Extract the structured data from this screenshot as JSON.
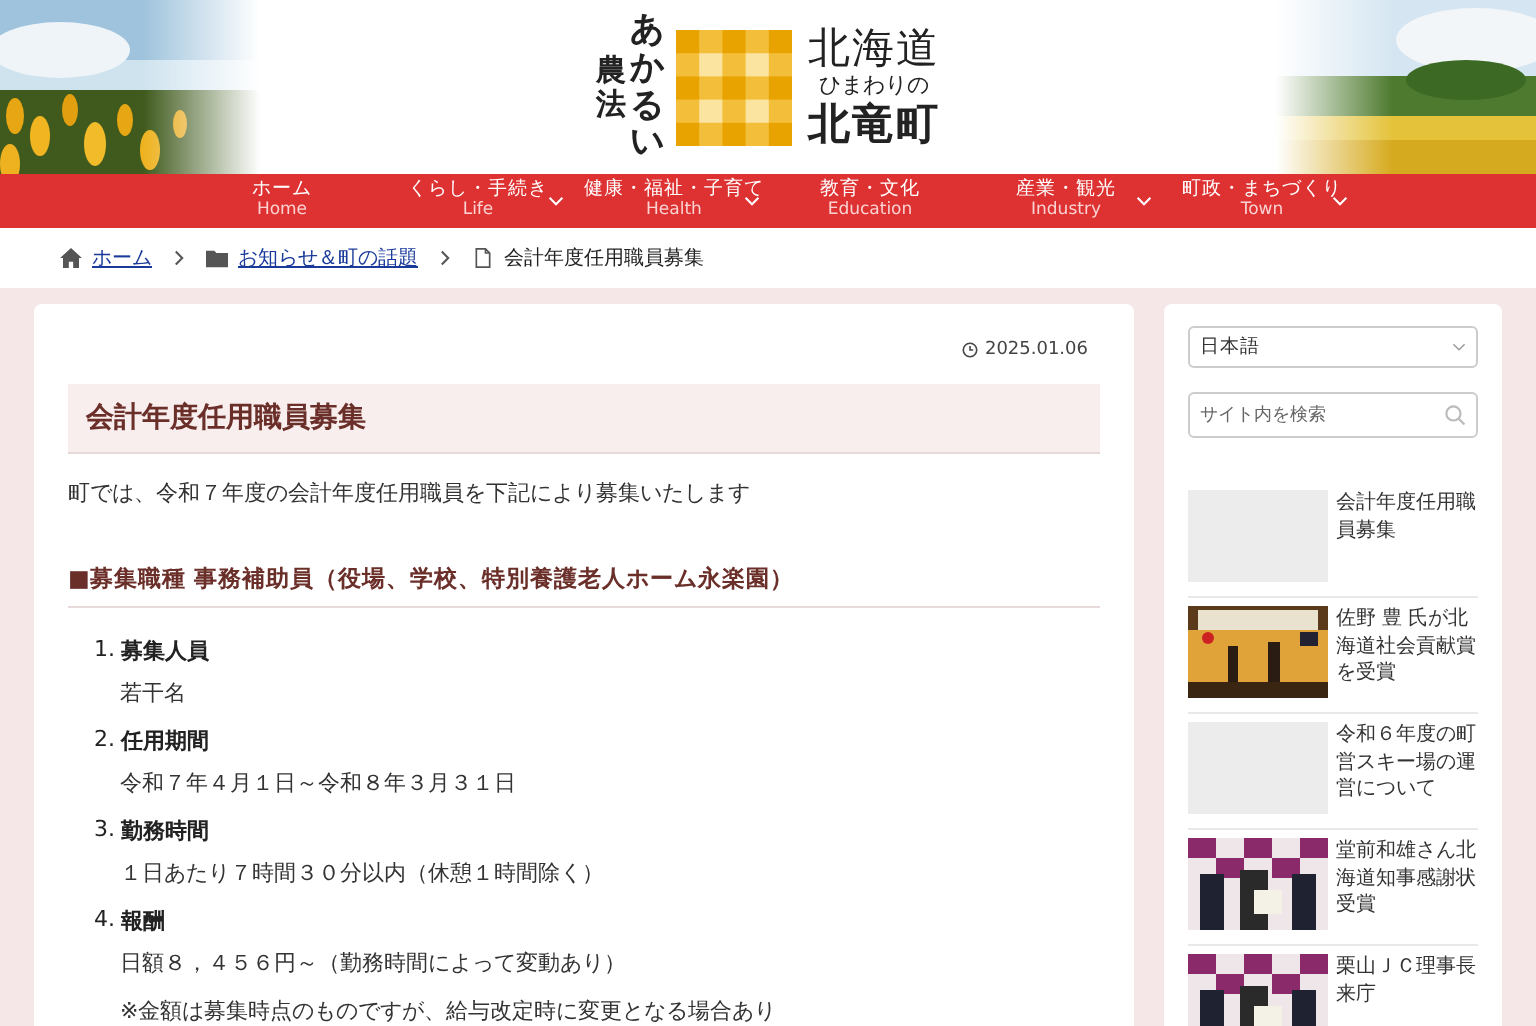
{
  "header": {
    "logo": {
      "columns": [
        "農法",
        "あかるい"
      ],
      "region": "北海道",
      "tagline": "ひまわりの",
      "town": "北竜町"
    }
  },
  "nav": [
    {
      "label": "ホーム",
      "sub": "Home",
      "has_submenu": false
    },
    {
      "label": "くらし・手続き",
      "sub": "Life",
      "has_submenu": true
    },
    {
      "label": "健康・福祉・子育て",
      "sub": "Health",
      "has_submenu": true
    },
    {
      "label": "教育・文化",
      "sub": "Education",
      "has_submenu": false
    },
    {
      "label": "産業・観光",
      "sub": "Industry",
      "has_submenu": true
    },
    {
      "label": "町政・まちづくり",
      "sub": "Town",
      "has_submenu": true
    }
  ],
  "breadcrumb": [
    {
      "label": "ホーム",
      "kind": "home"
    },
    {
      "label": "お知らせ＆町の話題",
      "kind": "folder"
    },
    {
      "label": "会計年度任用職員募集",
      "kind": "page"
    }
  ],
  "article": {
    "date": "2025.01.06",
    "title": "会計年度任用職員募集",
    "intro": "町では、令和７年度の会計年度任用職員を下記により募集いたします",
    "section": "■募集職種 事務補助員（役場、学校、特別養護老人ホーム永楽園）",
    "items": [
      {
        "number": "1.",
        "label": "募集人員",
        "lines": [
          "若干名"
        ]
      },
      {
        "number": "2.",
        "label": "任用期間",
        "lines": [
          "令和７年４月１日～令和８年３月３１日"
        ]
      },
      {
        "number": "3.",
        "label": "勤務時間",
        "lines": [
          "１日あたり７時間３０分以内（休憩１時間除く）"
        ]
      },
      {
        "number": "4.",
        "label": "報酬",
        "lines": [
          "日額８，４５６円～（勤務時間によって変動あり）",
          "※金額は募集時点のものですが、給与改定時に変更となる場合あり"
        ]
      }
    ]
  },
  "sidebar": {
    "language": "日本語",
    "search": {
      "placeholder": "サイト内を検索"
    },
    "posts": [
      {
        "title": "会計年度任用職員募集",
        "kind": "placeholder"
      },
      {
        "title": "佐野 豊 氏が北海道社会貢献賞を受賞",
        "kind": "picture"
      },
      {
        "title": "令和６年度の町営スキー場の運営について",
        "kind": "placeholder"
      },
      {
        "title": "堂前和雄さん北海道知事感謝状受賞",
        "kind": "picture"
      },
      {
        "title": "栗山ＪＣ理事長来庁",
        "kind": "picture"
      }
    ]
  }
}
